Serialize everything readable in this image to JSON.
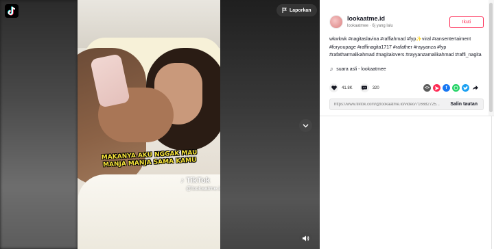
{
  "video": {
    "caption": "MAKANYA AKU NGGAK MAU MANJA MANJA SAMA KAMU",
    "watermark_logo": "TikTok",
    "watermark_user": "@lookaatme.id",
    "report_label": "Laporkan"
  },
  "author": {
    "username": "lookaatme.id",
    "subline": "lookaatmee · 6j yang lalu",
    "follow_label": "Ikuti"
  },
  "description": "wkwkwk #nagitaslavina #raffiahmad #fyp✨viral #ransentertaiment #foryoupage #raffinagita1717 #rafather #rayyanza #fyp #rafatharmalikahmad #nagitalovers #rayyanzamalikahmad #raffi_nagita",
  "music": "suara asli - lookaatmee",
  "stats": {
    "likes": "41.8K",
    "comments": "320"
  },
  "share_colors": {
    "embed": "#5b5b5b",
    "send": "#fe2c55",
    "facebook": "#1877f2",
    "whatsapp": "#25d366",
    "twitter": "#1da1f2"
  },
  "copy_link": {
    "url": "https://www.tiktok.com/@lookaatme.id/video/716682725...",
    "button_label": "Salin tautan"
  }
}
